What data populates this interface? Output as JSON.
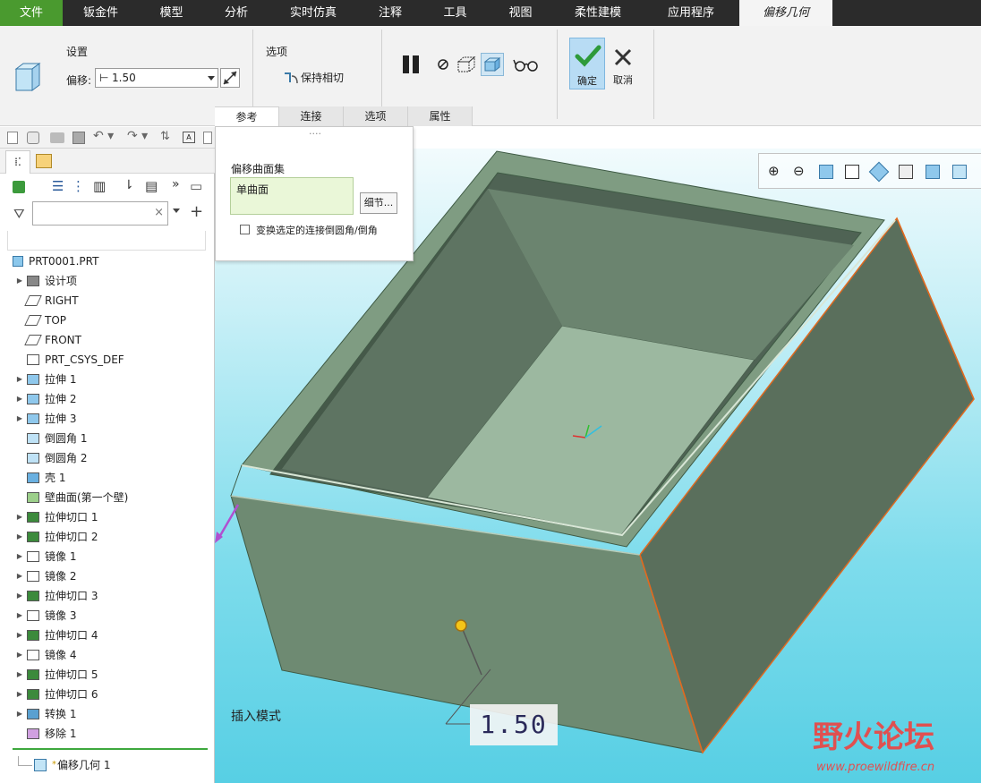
{
  "menubar": {
    "items": [
      "文件",
      "钣金件",
      "模型",
      "分析",
      "实时仿真",
      "注释",
      "工具",
      "视图",
      "柔性建模",
      "应用程序",
      "偏移几何"
    ],
    "active_index": 10
  },
  "ribbon": {
    "group_settings": "设置",
    "offset_label": "偏移:",
    "offset_value": "1.50",
    "group_options": "选项",
    "keep_tangent": "保持相切",
    "ok_label": "确定",
    "cancel_label": "取消",
    "tabs": [
      "参考",
      "连接",
      "选项",
      "属性"
    ],
    "active_tab": 0
  },
  "popup": {
    "dots": "....",
    "title": "偏移曲面集",
    "surface_item": "单曲面",
    "detail_button": "细节...",
    "checkbox_label": "变换选定的连接倒圆角/倒角",
    "checkbox_checked": false
  },
  "tree": {
    "root": "PRT0001.PRT",
    "items": [
      {
        "label": "设计项",
        "icon": "design-items-icon",
        "expand": true
      },
      {
        "label": "RIGHT",
        "icon": "datum-plane-icon",
        "expand": false
      },
      {
        "label": "TOP",
        "icon": "datum-plane-icon",
        "expand": false
      },
      {
        "label": "FRONT",
        "icon": "datum-plane-icon",
        "expand": false
      },
      {
        "label": "PRT_CSYS_DEF",
        "icon": "csys-icon",
        "expand": false
      },
      {
        "label": "拉伸 1",
        "icon": "extrude-icon",
        "expand": true
      },
      {
        "label": "拉伸 2",
        "icon": "extrude-icon",
        "expand": true
      },
      {
        "label": "拉伸 3",
        "icon": "extrude-icon",
        "expand": true
      },
      {
        "label": "倒圆角 1",
        "icon": "round-icon",
        "expand": false
      },
      {
        "label": "倒圆角 2",
        "icon": "round-icon",
        "expand": false
      },
      {
        "label": "壳 1",
        "icon": "shell-icon",
        "expand": false
      },
      {
        "label": "壁曲面(第一个壁)",
        "icon": "wall-surface-icon",
        "expand": false
      },
      {
        "label": "拉伸切口 1",
        "icon": "extrude-cut-icon",
        "expand": true
      },
      {
        "label": "拉伸切口 2",
        "icon": "extrude-cut-icon",
        "expand": true
      },
      {
        "label": "镜像 1",
        "icon": "mirror-icon",
        "expand": true
      },
      {
        "label": "镜像 2",
        "icon": "mirror-icon",
        "expand": true
      },
      {
        "label": "拉伸切口 3",
        "icon": "extrude-cut-icon",
        "expand": true
      },
      {
        "label": "镜像 3",
        "icon": "mirror-icon",
        "expand": true
      },
      {
        "label": "拉伸切口 4",
        "icon": "extrude-cut-icon",
        "expand": true
      },
      {
        "label": "镜像 4",
        "icon": "mirror-icon",
        "expand": true
      },
      {
        "label": "拉伸切口 5",
        "icon": "extrude-cut-icon",
        "expand": true
      },
      {
        "label": "拉伸切口 6",
        "icon": "extrude-cut-icon",
        "expand": true
      },
      {
        "label": "转换 1",
        "icon": "convert-icon",
        "expand": true
      },
      {
        "label": "移除 1",
        "icon": "remove-icon",
        "expand": false
      }
    ],
    "insert_item": "偏移几何 1",
    "insert_marker": "*"
  },
  "viewport": {
    "insert_mode": "插入模式",
    "dimension": "1.50"
  },
  "watermark": {
    "text": "野火论坛",
    "url": "www.proewildfire.cn"
  },
  "colors": {
    "accent_file": "#4a9a2f",
    "menubar_bg": "#2b2b2b",
    "model_face": "#6e8a72",
    "edge_highlight": "#e06a20"
  }
}
